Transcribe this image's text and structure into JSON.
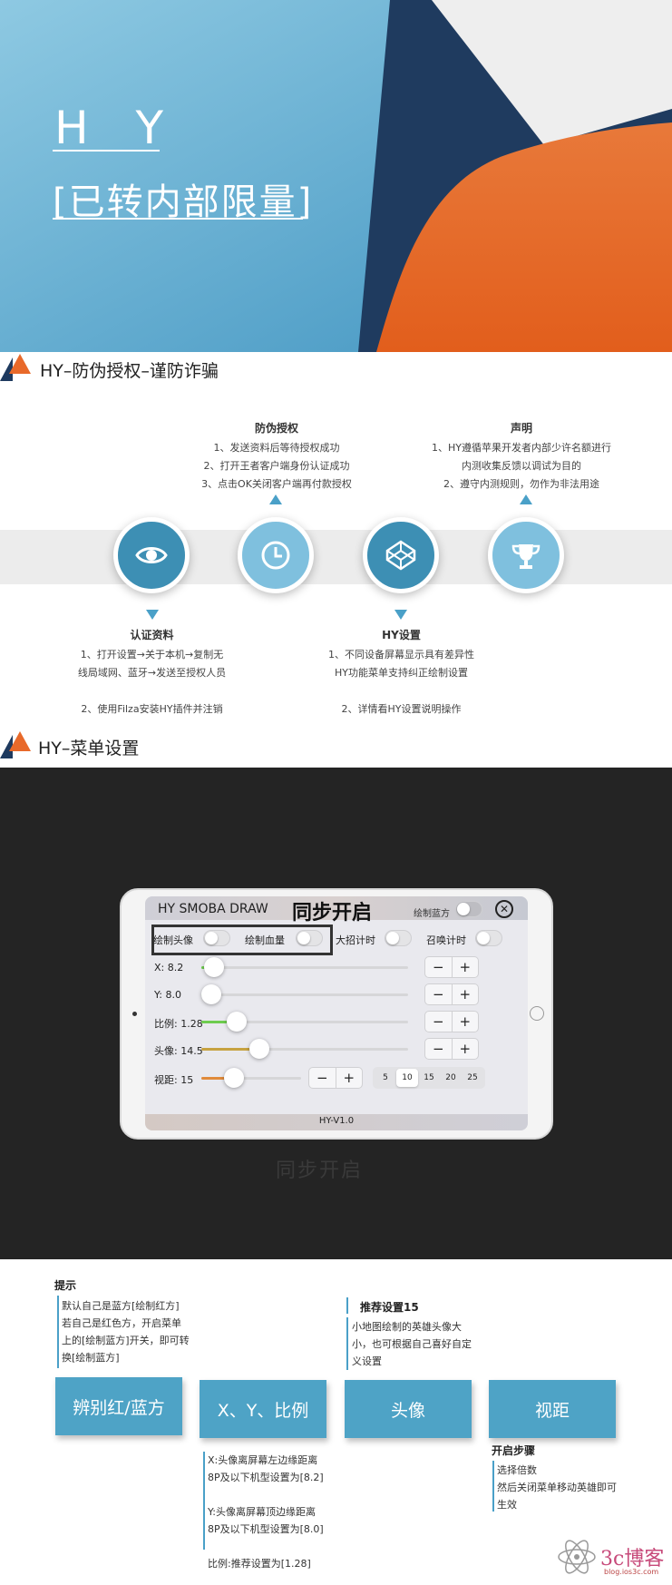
{
  "hero": {
    "title": "H Y",
    "subtitle": "[已转内部限量]"
  },
  "section1": {
    "heading": "HY–防伪授权–谨防诈骗",
    "anti_fake": {
      "title": "防伪授权",
      "lines": [
        "1、发送资料后等待授权成功",
        "2、打开王者客户端身份认证成功",
        "3、点击OK关闭客户端再付款授权"
      ]
    },
    "statement": {
      "title": "声明",
      "lines": [
        "1、HY遵循苹果开发者内部少许名额进行",
        "内测收集反馈以调试为目的",
        "2、遵守内测规则，勿作为非法用途"
      ]
    },
    "auth_info": {
      "title": "认证资料",
      "lines": [
        "1、打开设置→关于本机→复制无",
        "线局域网、蓝牙→发送至授权人员",
        "2、使用Filza安装HY插件并注销"
      ]
    },
    "hy_settings": {
      "title": "HY设置",
      "lines": [
        "1、不同设备屏幕显示具有差异性",
        "HY功能菜单支持纠正绘制设置",
        "2、详情看HY设置说明操作"
      ]
    }
  },
  "section2": {
    "heading": "HY–菜单设置",
    "menu": {
      "app_title": "HY SMOBA DRAW",
      "sync_label": "同步开启",
      "draw_blue": "绘制蓝方",
      "close": "✕",
      "toggles": [
        "绘制头像",
        "绘制血量",
        "大招计时",
        "召唤计时"
      ],
      "sliders": [
        {
          "label": "X:  8.2",
          "value": 8.2,
          "fraction": 0.06,
          "color": "#6dcc4e"
        },
        {
          "label": "Y:  8.0",
          "value": 8.0,
          "fraction": 0.05,
          "color": "#6dcc4e"
        },
        {
          "label": "比例:  1.28",
          "value": 1.28,
          "fraction": 0.17,
          "color": "#6dcc4e"
        },
        {
          "label": "头像:  14.5",
          "value": 14.5,
          "fraction": 0.28,
          "color": "#c7a240"
        },
        {
          "label": "视距:  15",
          "value": 15,
          "fraction": 0.33,
          "color": "#e08a3a"
        }
      ],
      "minus": "−",
      "plus": "+",
      "zoom_options": [
        "5",
        "10",
        "15",
        "20",
        "25"
      ],
      "zoom_selected": "10",
      "version": "HY-V1.0"
    },
    "reflection": "同步开启"
  },
  "section3": {
    "tip_title": "提示",
    "tip_lines": [
      "默认自己是蓝方[绘制红方]",
      "若自己是红色方，开启菜单",
      "上的[绘制蓝方]开关，即可转",
      "换[绘制蓝方]"
    ],
    "recommend_title": "推荐设置15",
    "recommend_lines": [
      "小地图绘制的英雄头像大",
      "小，也可根据自己喜好自定",
      "义设置"
    ],
    "buttons": [
      "辨别红/蓝方",
      "X、Y、比例",
      "头像",
      "视距"
    ],
    "xy_lines": [
      "X:头像离屏幕左边缘距离",
      "8P及以下机型设置为[8.2]",
      "",
      "Y:头像离屏幕顶边缘距离",
      "8P及以下机型设置为[8.0]",
      "",
      "比例:推荐设置为[1.28]"
    ],
    "steps_title": "开启步骤",
    "steps_lines": [
      "选择倍数",
      "然后关闭菜单移动英雄即可",
      "生效"
    ]
  },
  "watermark": {
    "text": "3c博客",
    "url": "blog.ios3c.com"
  }
}
